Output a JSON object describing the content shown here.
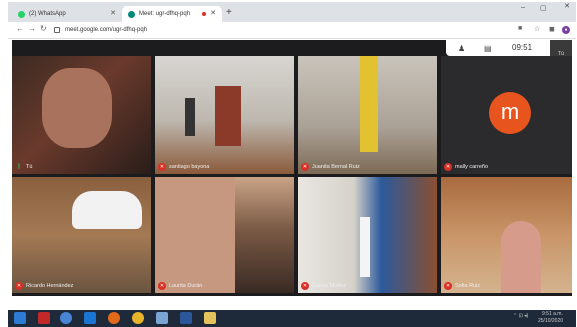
{
  "browser": {
    "tabs": [
      {
        "label": "(2) WhatsApp",
        "icon": "whatsapp-icon",
        "active": false
      },
      {
        "label": "Meet: ugr-dfhq-pqh",
        "icon": "meet-icon",
        "active": true
      }
    ],
    "new_tab": "+",
    "url": "meet.google.com/ugr-dfhq-pqh",
    "window_min": "–",
    "window_max": "▢",
    "window_close": "✕"
  },
  "meet": {
    "time": "09:51",
    "self_label": "Tú",
    "self_thumb_label": "Tú",
    "avatar_letter": "m",
    "participants": [
      {
        "name": "Tú",
        "muted": false
      },
      {
        "name": "santiago bayona",
        "muted": true
      },
      {
        "name": "Juanita Bernal Ruiz",
        "muted": true
      },
      {
        "name": "mally carreño",
        "muted": true
      },
      {
        "name": "Ricardo Hernández",
        "muted": true
      },
      {
        "name": "Laurita Durán",
        "muted": true
      },
      {
        "name": "Danna Muñoz",
        "muted": true
      },
      {
        "name": "Sofia Ruiz",
        "muted": true
      }
    ]
  },
  "taskbar": {
    "clock_time": "9:51 a.m.",
    "clock_date": "25/10/2020"
  },
  "colors": {
    "meet_bg": "#1c1c1e",
    "avatar": "#e8541e",
    "muted_badge": "#d93025"
  }
}
